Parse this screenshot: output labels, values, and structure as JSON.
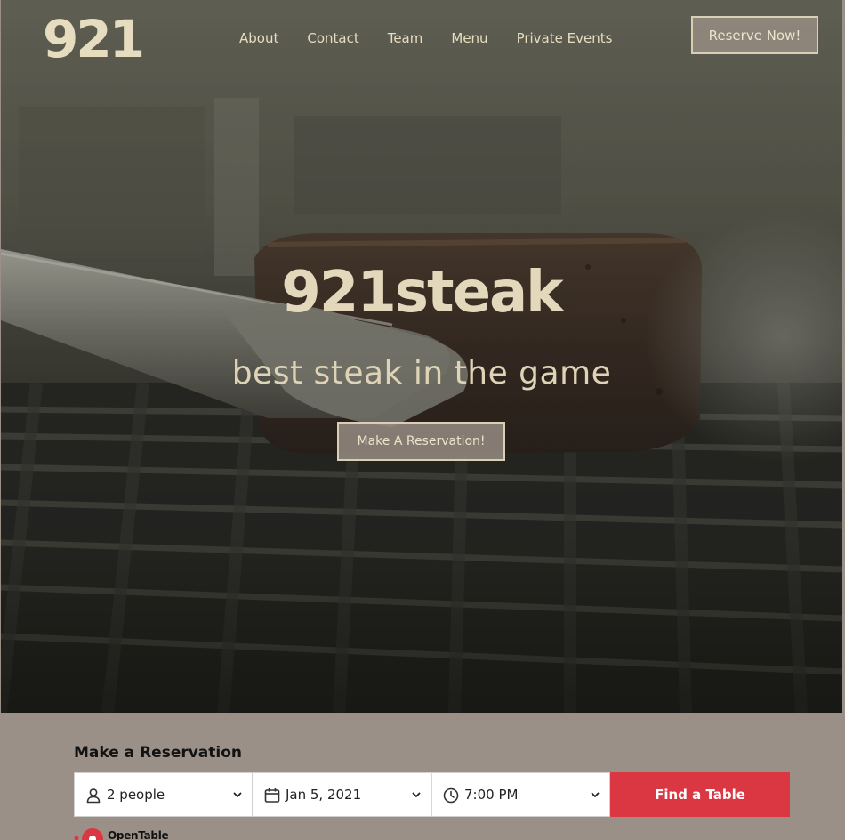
{
  "header": {
    "logo": "921",
    "nav": [
      "About",
      "Contact",
      "Team",
      "Menu",
      "Private Events"
    ],
    "reserve_button": "Reserve Now!"
  },
  "hero": {
    "title": "921steak",
    "subtitle": "best steak in the game",
    "cta_button": "Make A Reservation!"
  },
  "reservation": {
    "heading": "Make a Reservation",
    "party_size": "2 people",
    "date": "Jan 5, 2021",
    "time": "7:00 PM",
    "find_button": "Find a Table",
    "provider": "OpenTable"
  },
  "colors": {
    "accent_text": "#e3d8bb",
    "button_bg": "#968c82",
    "section_bg": "#9a9088",
    "find_button": "#da3743"
  },
  "icons": [
    "person-icon",
    "calendar-icon",
    "clock-icon",
    "chevron-down-icon",
    "opentable-icon"
  ]
}
